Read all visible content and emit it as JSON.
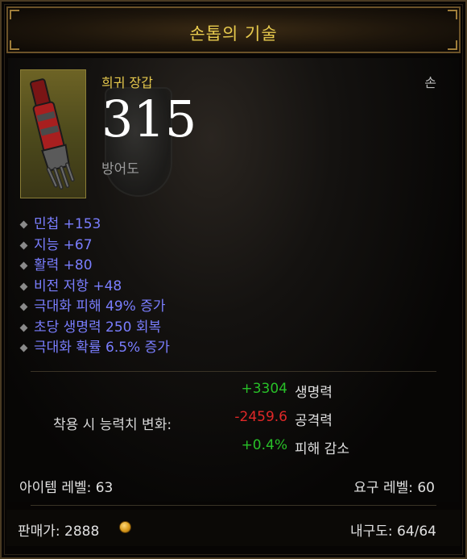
{
  "item": {
    "name": "손톱의 기술",
    "rarity": "희귀 장갑",
    "slot": "손",
    "armor_value": "315",
    "armor_label": "방어도"
  },
  "affixes": [
    "민첩 +153",
    "지능 +67",
    "활력 +80",
    "비전 저항 +48",
    "극대화 피해 49% 증가",
    "초당 생명력 250 회복",
    "극대화 확률 6.5% 증가"
  ],
  "stat_change": {
    "label": "착용 시 능력치 변화:",
    "rows": [
      {
        "value": "+3304",
        "name": "생명력"
      },
      {
        "value": "-2459.6",
        "name": "공격력"
      },
      {
        "value": "+0.4%",
        "name": "피해 감소"
      }
    ]
  },
  "levels": {
    "item_level": "아이템 레벨: 63",
    "required_level": "요구 레벨: 60"
  },
  "footer": {
    "sell_value": "판매가: 2888",
    "durability": "내구도: 64/64"
  },
  "colors": {
    "title": "#e6c94d",
    "affix": "#7a7eff",
    "positive": "#28c028",
    "negative": "#e02828"
  },
  "icons": [
    "glove-item-icon",
    "gold-coin-icon",
    "diamond-bullet-icon"
  ]
}
